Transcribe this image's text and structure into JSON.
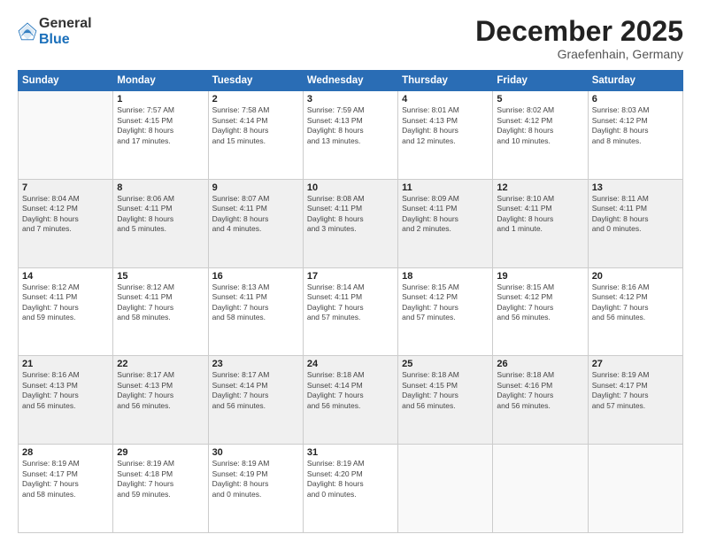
{
  "logo": {
    "general": "General",
    "blue": "Blue"
  },
  "title": "December 2025",
  "location": "Graefenhain, Germany",
  "days_header": [
    "Sunday",
    "Monday",
    "Tuesday",
    "Wednesday",
    "Thursday",
    "Friday",
    "Saturday"
  ],
  "weeks": [
    [
      {
        "day": "",
        "info": ""
      },
      {
        "day": "1",
        "info": "Sunrise: 7:57 AM\nSunset: 4:15 PM\nDaylight: 8 hours\nand 17 minutes."
      },
      {
        "day": "2",
        "info": "Sunrise: 7:58 AM\nSunset: 4:14 PM\nDaylight: 8 hours\nand 15 minutes."
      },
      {
        "day": "3",
        "info": "Sunrise: 7:59 AM\nSunset: 4:13 PM\nDaylight: 8 hours\nand 13 minutes."
      },
      {
        "day": "4",
        "info": "Sunrise: 8:01 AM\nSunset: 4:13 PM\nDaylight: 8 hours\nand 12 minutes."
      },
      {
        "day": "5",
        "info": "Sunrise: 8:02 AM\nSunset: 4:12 PM\nDaylight: 8 hours\nand 10 minutes."
      },
      {
        "day": "6",
        "info": "Sunrise: 8:03 AM\nSunset: 4:12 PM\nDaylight: 8 hours\nand 8 minutes."
      }
    ],
    [
      {
        "day": "7",
        "info": "Sunrise: 8:04 AM\nSunset: 4:12 PM\nDaylight: 8 hours\nand 7 minutes."
      },
      {
        "day": "8",
        "info": "Sunrise: 8:06 AM\nSunset: 4:11 PM\nDaylight: 8 hours\nand 5 minutes."
      },
      {
        "day": "9",
        "info": "Sunrise: 8:07 AM\nSunset: 4:11 PM\nDaylight: 8 hours\nand 4 minutes."
      },
      {
        "day": "10",
        "info": "Sunrise: 8:08 AM\nSunset: 4:11 PM\nDaylight: 8 hours\nand 3 minutes."
      },
      {
        "day": "11",
        "info": "Sunrise: 8:09 AM\nSunset: 4:11 PM\nDaylight: 8 hours\nand 2 minutes."
      },
      {
        "day": "12",
        "info": "Sunrise: 8:10 AM\nSunset: 4:11 PM\nDaylight: 8 hours\nand 1 minute."
      },
      {
        "day": "13",
        "info": "Sunrise: 8:11 AM\nSunset: 4:11 PM\nDaylight: 8 hours\nand 0 minutes."
      }
    ],
    [
      {
        "day": "14",
        "info": "Sunrise: 8:12 AM\nSunset: 4:11 PM\nDaylight: 7 hours\nand 59 minutes."
      },
      {
        "day": "15",
        "info": "Sunrise: 8:12 AM\nSunset: 4:11 PM\nDaylight: 7 hours\nand 58 minutes."
      },
      {
        "day": "16",
        "info": "Sunrise: 8:13 AM\nSunset: 4:11 PM\nDaylight: 7 hours\nand 58 minutes."
      },
      {
        "day": "17",
        "info": "Sunrise: 8:14 AM\nSunset: 4:11 PM\nDaylight: 7 hours\nand 57 minutes."
      },
      {
        "day": "18",
        "info": "Sunrise: 8:15 AM\nSunset: 4:12 PM\nDaylight: 7 hours\nand 57 minutes."
      },
      {
        "day": "19",
        "info": "Sunrise: 8:15 AM\nSunset: 4:12 PM\nDaylight: 7 hours\nand 56 minutes."
      },
      {
        "day": "20",
        "info": "Sunrise: 8:16 AM\nSunset: 4:12 PM\nDaylight: 7 hours\nand 56 minutes."
      }
    ],
    [
      {
        "day": "21",
        "info": "Sunrise: 8:16 AM\nSunset: 4:13 PM\nDaylight: 7 hours\nand 56 minutes."
      },
      {
        "day": "22",
        "info": "Sunrise: 8:17 AM\nSunset: 4:13 PM\nDaylight: 7 hours\nand 56 minutes."
      },
      {
        "day": "23",
        "info": "Sunrise: 8:17 AM\nSunset: 4:14 PM\nDaylight: 7 hours\nand 56 minutes."
      },
      {
        "day": "24",
        "info": "Sunrise: 8:18 AM\nSunset: 4:14 PM\nDaylight: 7 hours\nand 56 minutes."
      },
      {
        "day": "25",
        "info": "Sunrise: 8:18 AM\nSunset: 4:15 PM\nDaylight: 7 hours\nand 56 minutes."
      },
      {
        "day": "26",
        "info": "Sunrise: 8:18 AM\nSunset: 4:16 PM\nDaylight: 7 hours\nand 56 minutes."
      },
      {
        "day": "27",
        "info": "Sunrise: 8:19 AM\nSunset: 4:17 PM\nDaylight: 7 hours\nand 57 minutes."
      }
    ],
    [
      {
        "day": "28",
        "info": "Sunrise: 8:19 AM\nSunset: 4:17 PM\nDaylight: 7 hours\nand 58 minutes."
      },
      {
        "day": "29",
        "info": "Sunrise: 8:19 AM\nSunset: 4:18 PM\nDaylight: 7 hours\nand 59 minutes."
      },
      {
        "day": "30",
        "info": "Sunrise: 8:19 AM\nSunset: 4:19 PM\nDaylight: 8 hours\nand 0 minutes."
      },
      {
        "day": "31",
        "info": "Sunrise: 8:19 AM\nSunset: 4:20 PM\nDaylight: 8 hours\nand 0 minutes."
      },
      {
        "day": "",
        "info": ""
      },
      {
        "day": "",
        "info": ""
      },
      {
        "day": "",
        "info": ""
      }
    ]
  ]
}
